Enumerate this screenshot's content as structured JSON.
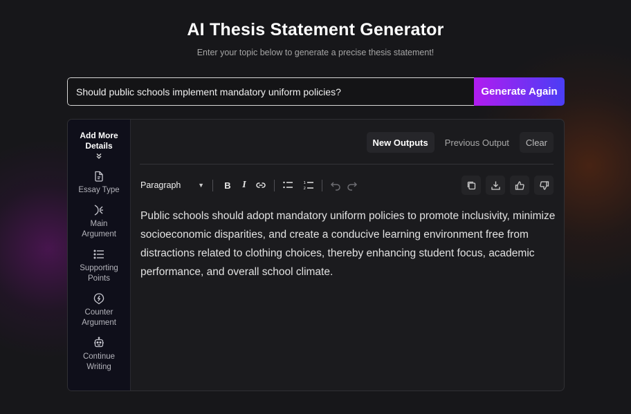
{
  "header": {
    "title": "AI Thesis Statement Generator",
    "subtitle": "Enter your topic below to generate a precise thesis statement!"
  },
  "topic": {
    "value": "Should public schools implement mandatory uniform policies?",
    "generate_label": "Generate Again"
  },
  "sidebar": {
    "heading_line1": "Add More",
    "heading_line2": "Details",
    "expand_icon": "chevrons-down-icon",
    "items": [
      {
        "line1": "Essay Type",
        "line2": "",
        "icon": "document-icon"
      },
      {
        "line1": "Main",
        "line2": "Argument",
        "icon": "merge-arrows-icon"
      },
      {
        "line1": "Supporting",
        "line2": "Points",
        "icon": "list-icon"
      },
      {
        "line1": "Counter",
        "line2": "Argument",
        "icon": "lightning-bubble-icon"
      },
      {
        "line1": "Continue",
        "line2": "Writing",
        "icon": "robot-icon"
      }
    ]
  },
  "tabs": {
    "new_outputs": "New Outputs",
    "previous_output": "Previous Output",
    "clear": "Clear"
  },
  "toolbar": {
    "block_format": "Paragraph",
    "bold": "B",
    "italic": "I"
  },
  "output": {
    "text": "Public schools should adopt mandatory uniform policies to promote inclusivity, minimize socioeconomic disparities, and create a conducive learning environment free from distractions related to clothing choices, thereby enhancing student focus, academic performance, and overall school climate."
  },
  "colors": {
    "accent_start": "#b11cf0",
    "accent_end": "#4a3ef5",
    "background": "#17171a",
    "sidebar_bg": "#0f0f1a"
  }
}
